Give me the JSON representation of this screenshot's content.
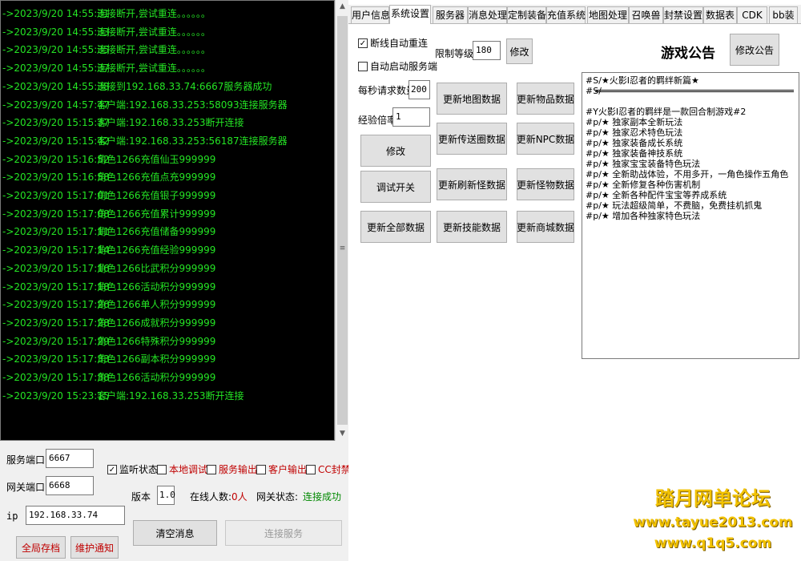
{
  "console": {
    "logs": [
      {
        "time": "->2023/9/20 14:55:31",
        "msg": "连接断开,尝试重连。。。。。。"
      },
      {
        "time": "->2023/9/20 14:55:33",
        "msg": "连接断开,尝试重连。。。。。。"
      },
      {
        "time": "->2023/9/20 14:55:35",
        "msg": "连接断开,尝试重连。。。。。。"
      },
      {
        "time": "->2023/9/20 14:55:37",
        "msg": "连接断开,尝试重连。。。。。。"
      },
      {
        "time": "->2023/9/20 14:55:38",
        "msg": "连接到192.168.33.74:6667服务器成功"
      },
      {
        "time": "->2023/9/20 14:57:47",
        "msg": "客户端:192.168.33.253:58093连接服务器"
      },
      {
        "time": "->2023/9/20 15:15:37",
        "msg": "客户端:192.168.33.253断开连接"
      },
      {
        "time": "->2023/9/20 15:15:42",
        "msg": "客户端:192.168.33.253:56187连接服务器"
      },
      {
        "time": "->2023/9/20 15:16:52",
        "msg": "角色1266充值仙玉999999"
      },
      {
        "time": "->2023/9/20 15:16:58",
        "msg": "角色1266充值点充999999"
      },
      {
        "time": "->2023/9/20 15:17:01",
        "msg": "角色1266充值银子999999"
      },
      {
        "time": "->2023/9/20 15:17:08",
        "msg": "角色1266充值累计999999"
      },
      {
        "time": "->2023/9/20 15:17:11",
        "msg": "角色1266充值储备999999"
      },
      {
        "time": "->2023/9/20 15:17:14",
        "msg": "角色1266充值经验999999"
      },
      {
        "time": "->2023/9/20 15:17:16",
        "msg": "角色1266比武积分999999"
      },
      {
        "time": "->2023/9/20 15:17:18",
        "msg": "角色1266活动积分999999"
      },
      {
        "time": "->2023/9/20 15:17:26",
        "msg": "角色1266单人积分999999"
      },
      {
        "time": "->2023/9/20 15:17:28",
        "msg": "角色1266成就积分999999"
      },
      {
        "time": "->2023/9/20 15:17:29",
        "msg": "角色1266特殊积分999999"
      },
      {
        "time": "->2023/9/20 15:17:33",
        "msg": "角色1266副本积分999999"
      },
      {
        "time": "->2023/9/20 15:17:38",
        "msg": "角色1266活动积分999999"
      },
      {
        "time": "->2023/9/20 15:23:15",
        "msg": "客户端:192.168.33.253断开连接"
      }
    ]
  },
  "controls": {
    "service_port_label": "服务端口",
    "service_port_value": "6667",
    "gateway_port_label": "网关端口",
    "gateway_port_value": "6668",
    "ip_label": "ip",
    "ip_value": "192.168.33.74",
    "listen_label": "监听状态",
    "listen_mark": "✓",
    "local_debug_label": "本地调试",
    "service_output_label": "服务输出",
    "client_output_label": "客户输出",
    "cc_block_label": "CC封禁",
    "version_label": "版本",
    "version_value": "1.0",
    "online_label": "在线人数:",
    "online_value": "0人",
    "gateway_status_label": "网关状态:",
    "gateway_status_value": "连接成功",
    "clear_button": "清空消息",
    "connect_button": "连接服务",
    "save_all_button": "全局存档",
    "maintenance_button": "维护通知"
  },
  "tabs": [
    {
      "label": "用户信息"
    },
    {
      "label": "系统设置"
    },
    {
      "label": "服务器"
    },
    {
      "label": "消息处理"
    },
    {
      "label": "定制装备"
    },
    {
      "label": "充值系统"
    },
    {
      "label": "地图处理"
    },
    {
      "label": "召唤兽"
    },
    {
      "label": "封禁设置"
    },
    {
      "label": "数据表"
    },
    {
      "label": "CDK"
    },
    {
      "label": "bb装"
    }
  ],
  "settings": {
    "auto_reconnect_label": "断线自动重连",
    "auto_reconnect_mark": "✓",
    "auto_start_label": "自动启动服务端",
    "level_limit_label": "限制等级",
    "level_limit_value": "180",
    "level_modify_button": "修改",
    "requests_label": "每秒请求数量",
    "requests_value": "200",
    "exp_label": "经验倍率",
    "exp_value": "1",
    "modify_button": "修改",
    "debug_switch_button": "调试开关",
    "update_all_button": "更新全部数据",
    "update_map_button": "更新地图数据",
    "update_item_button": "更新物品数据",
    "update_teleport_button": "更新传送圈数据",
    "update_npc_button": "更新NPC数据",
    "update_refresh_button": "更新刷新怪数据",
    "update_monster_button": "更新怪物数据",
    "update_skill_button": "更新技能数据",
    "update_shop_button": "更新商城数据"
  },
  "notice": {
    "title": "游戏公告",
    "modify_button": "修改公告",
    "lines": [
      "#S/★火影Ⅰ忍者的羁绊新篇★",
      "#S/",
      "",
      "#Y火影Ⅰ忍者的羁绊是一款回合制游戏#2",
      "#p/★ 独家副本全新玩法",
      "#p/★ 独家忍术特色玩法",
      "#p/★ 独家装备成长系统",
      "#p/★ 独家装备神技系统",
      "#p/★ 独家宝宝装备特色玩法",
      "#p/★ 全新助战体验，不用多开，一角色操作五角色",
      "#p/★ 全新修复各种伤害机制",
      "#p/★ 全新各种配件宝宝等养成系统",
      "#p/★ 玩法超级简单，不费脑，免费挂机抓鬼",
      "#p/★ 增加各种独家特色玩法"
    ]
  },
  "watermark": {
    "line1": "踏月网单论坛",
    "line2": "www.tayue2013.com",
    "line3": "www.q1q5.com"
  }
}
